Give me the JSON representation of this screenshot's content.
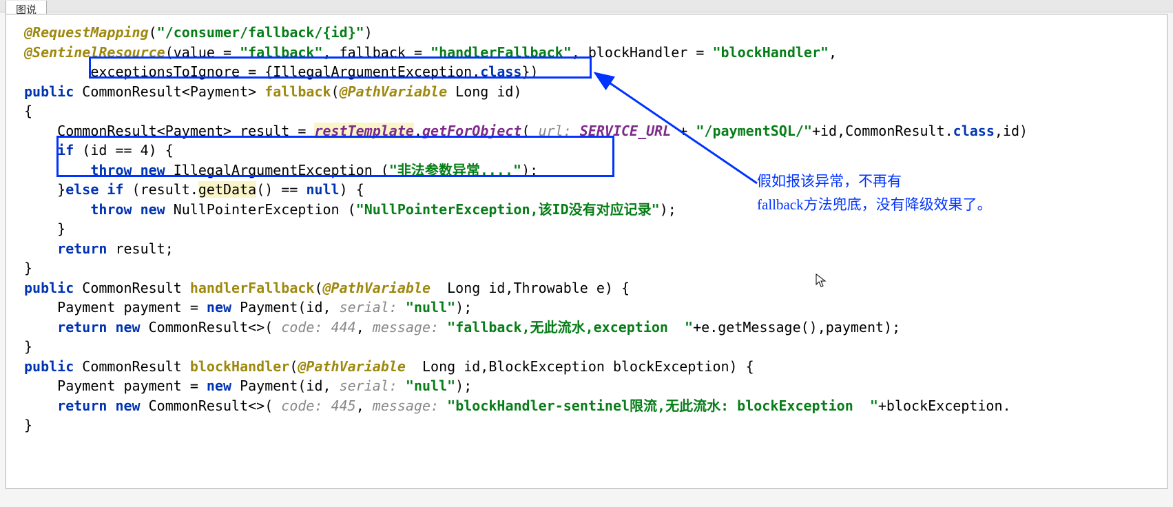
{
  "tab": {
    "title": "图说"
  },
  "code": {
    "line1_ann": "@RequestMapping",
    "line1_rest": "(",
    "line1_str": "\"/consumer/fallback/{id}\"",
    "line1_end": ")",
    "line2_ann": "@SentinelResource",
    "line2_a": "(value = ",
    "line2_str1": "\"fallback\"",
    "line2_b": ", fallback = ",
    "line2_str2": "\"handlerFallback\"",
    "line2_c": ", blockHandler = ",
    "line2_str3": "\"blockHandler\"",
    "line2_d": ",",
    "line3_a": "        exceptionsToIgnore = {IllegalArgumentException.",
    "line3_kw": "class",
    "line3_b": "})",
    "line4_kw1": "public",
    "line4_a": " CommonResult<Payment> ",
    "line4_method": "fallback",
    "line4_b": "(",
    "line4_ann": "@PathVariable",
    "line4_c": " Long id)",
    "line5": "{",
    "line6_a": "    CommonResult<Payment> result = ",
    "line6_m1": "restTemplate",
    "line6_b": ".",
    "line6_m2": "getForObject",
    "line6_c": "( ",
    "line6_param": "url:",
    "line6_sp": " ",
    "line6_var": "SERVICE_URL",
    "line6_d": " + ",
    "line6_str": "\"/paymentSQL/\"",
    "line6_e": "+id,CommonResult.",
    "line6_kw": "class",
    "line6_f": ",id)",
    "line7_kw": "if",
    "line7_a": " (id == ",
    "line7_num": "4",
    "line7_b": ") {",
    "line8_kw": "throw new",
    "line8_a": " IllegalArgumentException (",
    "line8_str": "\"非法参数异常....\"",
    "line8_b": ");",
    "line9_a": "    }",
    "line9_kw": "else if",
    "line9_b": " (result.",
    "line9_m": "getData",
    "line9_c": "() == ",
    "line9_kw2": "null",
    "line9_d": ") {",
    "line10_kw": "throw new",
    "line10_a": " NullPointerException (",
    "line10_str": "\"NullPointerException,该ID没有对应记录\"",
    "line10_b": ");",
    "line11": "    }",
    "line12_kw": "return",
    "line12_a": " result;",
    "line13": "}",
    "line14_kw": "public",
    "line14_a": " CommonResult ",
    "line14_m": "handlerFallback",
    "line14_b": "(",
    "line14_ann": "@PathVariable",
    "line14_c": "  Long id,Throwable e) {",
    "line15_a": "    Payment payment = ",
    "line15_kw": "new",
    "line15_b": " Payment(id, ",
    "line15_param": "serial:",
    "line15_sp": " ",
    "line15_str": "\"null\"",
    "line15_c": ");",
    "line16_kw": "return new",
    "line16_a": " CommonResult<>( ",
    "line16_p1": "code:",
    "line16_sp1": " ",
    "line16_n1": "444",
    "line16_b": ", ",
    "line16_p2": "message:",
    "line16_sp2": " ",
    "line16_str": "\"fallback,无此流水,exception  \"",
    "line16_c": "+e.getMessage(),payment);",
    "line17": "}",
    "line18_kw": "public",
    "line18_a": " CommonResult ",
    "line18_m": "blockHandler",
    "line18_b": "(",
    "line18_ann": "@PathVariable",
    "line18_c": "  Long id,BlockException blockException) {",
    "line19_a": "    Payment payment = ",
    "line19_kw": "new",
    "line19_b": " Payment(id, ",
    "line19_param": "serial:",
    "line19_sp": " ",
    "line19_str": "\"null\"",
    "line19_c": ");",
    "line20_kw": "return new",
    "line20_a": " CommonResult<>( ",
    "line20_p1": "code:",
    "line20_sp1": " ",
    "line20_n1": "445",
    "line20_b": ", ",
    "line20_p2": "message:",
    "line20_sp2": " ",
    "line20_str": "\"blockHandler-sentinel限流,无此流水: blockException  \"",
    "line20_c": "+blockException.",
    "line21": "}"
  },
  "annotation": {
    "line1": "假如报该异常，不再有",
    "line2": "fallback方法兜底，没有降级效果了。"
  }
}
